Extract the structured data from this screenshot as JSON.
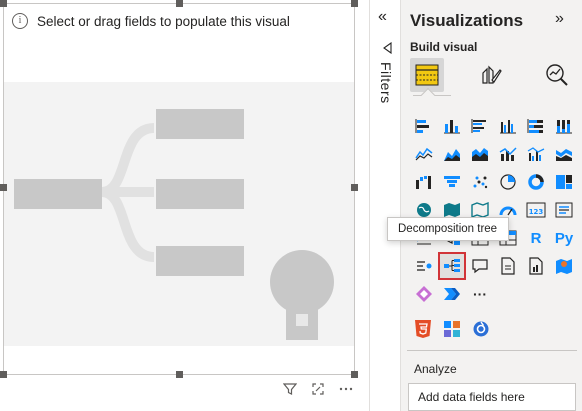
{
  "canvas": {
    "visual_prompt": "Select or drag fields to populate this visual"
  },
  "filters": {
    "label": "Filters",
    "collapse_glyph": "«"
  },
  "visualizations": {
    "title": "Visualizations",
    "expand_glyph": "»",
    "build_label": "Build visual",
    "tooltip": "Decomposition tree",
    "text_icons": {
      "r_visual": "R",
      "python_visual": "Py",
      "more": "···"
    },
    "colors": {
      "accent_yellow": "#f2c811",
      "accent_blue": "#118dff",
      "selected_outline": "#d13438",
      "icon_teal": "#0e7a8a",
      "icon_dark": "#252423"
    }
  },
  "analyze": {
    "label": "Analyze",
    "field_placeholder": "Add data fields here"
  }
}
